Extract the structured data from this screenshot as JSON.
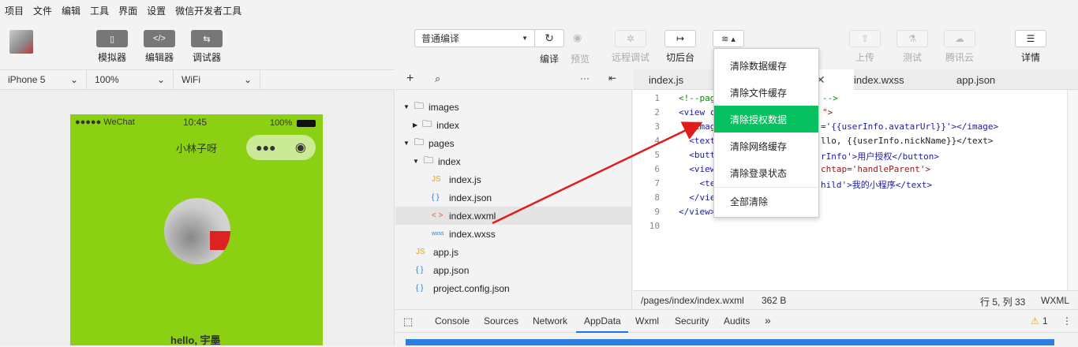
{
  "menubar": [
    "项目",
    "文件",
    "编辑",
    "工具",
    "界面",
    "设置",
    "微信开发者工具"
  ],
  "toolbar": {
    "simulator": "模拟器",
    "editor": "编辑器",
    "debugger": "调试器",
    "compile_mode": "普通编译",
    "compile": "编译",
    "preview": "预览",
    "remote_debug": "远程调试",
    "background": "切后台",
    "upload": "上传",
    "test": "测试",
    "tencent_cloud": "腾讯云",
    "details": "详情"
  },
  "device": {
    "model": "iPhone 5",
    "zoom": "100%",
    "network": "WiFi"
  },
  "phone": {
    "signal": "●●●●● WeChat",
    "time": "10:45",
    "battery": "100%",
    "nav_title": "小林子呀",
    "greeting": "hello, 宇墨"
  },
  "tree": {
    "items": [
      {
        "label": "images",
        "icon": "folder-icon"
      },
      {
        "label": "index",
        "icon": "folder-icon"
      },
      {
        "label": "pages",
        "icon": "folder-icon"
      },
      {
        "label": "index",
        "icon": "folder-icon"
      },
      {
        "label": "index.js",
        "badge": "JS"
      },
      {
        "label": "index.json",
        "badge": "{ }"
      },
      {
        "label": "index.wxml",
        "badge": "< >"
      },
      {
        "label": "index.wxss",
        "badge": "wxss"
      },
      {
        "label": "app.js",
        "badge": "JS"
      },
      {
        "label": "app.json",
        "badge": "{ }"
      },
      {
        "label": "project.config.json",
        "badge": "{ }"
      }
    ]
  },
  "tabs": [
    "index.js",
    "index.wxss",
    "app.json"
  ],
  "code": {
    "line_numbers": [
      "1",
      "2",
      "3",
      "4",
      "5",
      "6",
      "7",
      "8",
      "9",
      "10"
    ],
    "lines": [
      "<!--pag",
      "<view c",
      "  <imag",
      "  <text",
      "  <butt",
      "  <view",
      "    <te",
      "  </vie",
      "</view>",
      ""
    ],
    "right": [
      "-->",
      "\">",
      "='{{userInfo.avatarUrl}}'></image>",
      "llo, {{userInfo.nickName}}</text>",
      "rInfo'>用户授权</button>",
      "chtap='handleParent'>",
      "hild'>我的小程序</text>",
      "",
      "",
      ""
    ]
  },
  "status": {
    "path": "/pages/index/index.wxml",
    "size": "362 B",
    "position": "行 5, 列 33",
    "lang": "WXML"
  },
  "devtools": {
    "tabs": [
      "Console",
      "Sources",
      "Network",
      "AppData",
      "Wxml",
      "Security",
      "Audits"
    ],
    "more": "»",
    "warnings": "1"
  },
  "menu": {
    "items": [
      "清除数据缓存",
      "清除文件缓存",
      "清除授权数据",
      "清除网络缓存",
      "清除登录状态",
      "全部清除"
    ]
  },
  "colors": {
    "accent": "#07c160",
    "phone_bg": "#8cd014",
    "arrow": "#e31b1b"
  }
}
